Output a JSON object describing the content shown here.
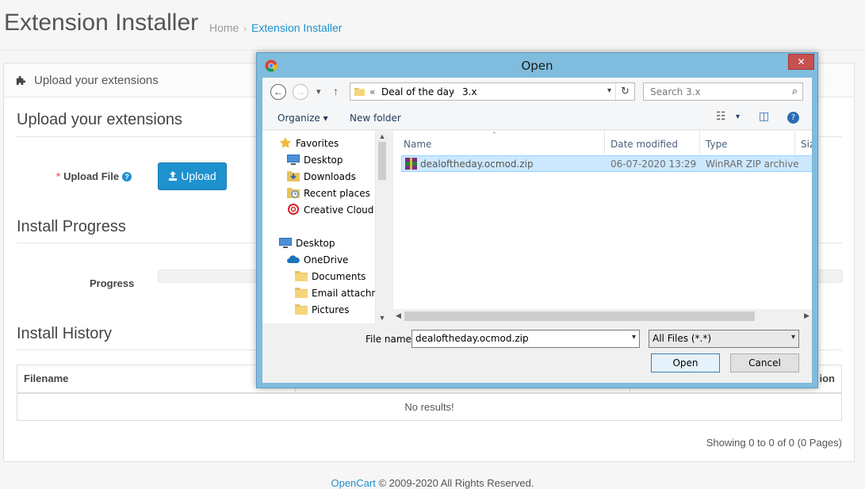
{
  "page": {
    "title": "Extension Installer",
    "breadcrumb": [
      "Home",
      "Extension Installer"
    ],
    "breadcrumb_sep": "›"
  },
  "panel": {
    "heading": "Upload your extensions",
    "upload_section_title": "Upload your extensions",
    "upload_label": "Upload File",
    "required_mark": "*",
    "help_glyph": "?",
    "upload_button": "Upload",
    "progress_section_title": "Install Progress",
    "progress_label": "Progress",
    "progress_value": 0,
    "history_section_title": "Install History",
    "history_columns": [
      "Filename",
      "",
      "ion"
    ],
    "history_empty": "No results!",
    "showing": "Showing 0 to 0 of 0 (0 Pages)"
  },
  "footer": {
    "link": "OpenCart",
    "text": " © 2009-2020 All Rights Reserved."
  },
  "dialog": {
    "title": "Open",
    "close_glyph": "✕",
    "back_glyph": "←",
    "forward_glyph": "→",
    "recent_glyph": "▾",
    "up_glyph": "↑",
    "address": {
      "prefix": "«",
      "path": [
        "Deal of the day",
        "3.x"
      ],
      "sep": "›",
      "dropdown_glyph": "▾",
      "refresh_glyph": "↻"
    },
    "search_placeholder": "Search 3.x",
    "search_glyph": "⌕",
    "toolbar": {
      "organize": "Organize",
      "organize_caret": "▾",
      "new_folder": "New folder",
      "view_glyph": "☷",
      "view_caret": "▾",
      "pane_glyph": "◫",
      "help_glyph": "?"
    },
    "nav_items": [
      {
        "label": "Favorites",
        "icon": "star-icon"
      },
      {
        "label": "Desktop",
        "icon": "desktop-icon"
      },
      {
        "label": "Downloads",
        "icon": "downloads-icon"
      },
      {
        "label": "Recent places",
        "icon": "recent-places-icon"
      },
      {
        "label": "Creative Cloud Fi",
        "icon": "creative-cloud-icon"
      },
      {
        "label": "Desktop",
        "icon": "desktop-icon"
      },
      {
        "label": "OneDrive",
        "icon": "onedrive-icon"
      },
      {
        "label": "Documents",
        "icon": "folder-icon"
      },
      {
        "label": "Email attachme",
        "icon": "folder-icon"
      },
      {
        "label": "Pictures",
        "icon": "folder-icon"
      }
    ],
    "scroll_up": "▲",
    "scroll_down": "▼",
    "scroll_left": "◀",
    "scroll_right": "▶",
    "columns": [
      "Name",
      "Date modified",
      "Type",
      "Siz"
    ],
    "sort_glyph": "˄",
    "files": [
      {
        "name": "dealoftheday.ocmod.zip",
        "date": "06-07-2020 13:29",
        "type": "WinRAR ZIP archive"
      }
    ],
    "file_name_label": "File name:",
    "file_name_value": "dealoftheday.ocmod.zip",
    "filter_value": "All Files (*.*)",
    "select_caret": "▾",
    "open_button": "Open",
    "cancel_button": "Cancel"
  },
  "colors": {
    "accent": "#1e91cf",
    "required": "#f56b6b",
    "dialog_frame": "#7fbcdd",
    "selection": "#cce8ff"
  }
}
